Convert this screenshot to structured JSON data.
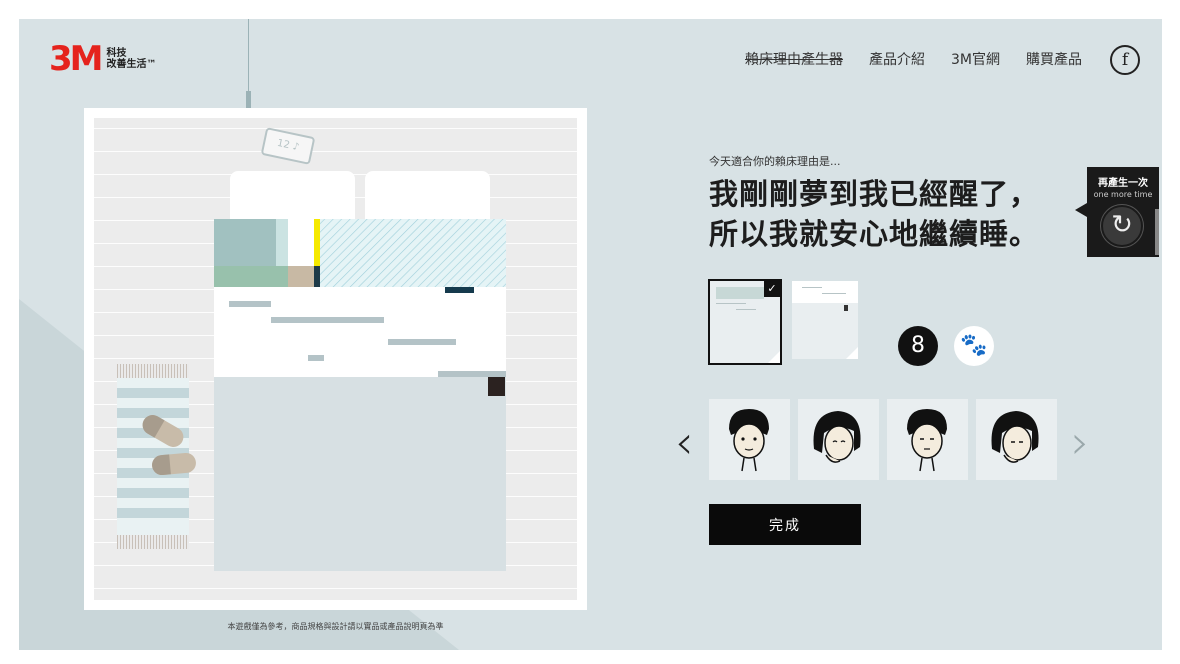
{
  "brand": {
    "logo_mark": "3M",
    "logo_line1": "科技",
    "logo_line2": "改善生活™"
  },
  "nav": {
    "items": [
      "賴床理由產生器",
      "產品介紹",
      "3M官網",
      "購買產品"
    ],
    "facebook_icon": "f"
  },
  "room": {
    "clock_text": "12 ♪",
    "disclaimer": "本遊戲僅為參考，商品規格與設計請以實品或產品說明頁為準"
  },
  "result": {
    "subtitle": "今天適合你的賴床理由是...",
    "line1": "我剛剛夢到我已經醒了，",
    "line2": "所以我就安心地繼續睡。"
  },
  "regen": {
    "title": "再產生一次",
    "subtitle": "one more time",
    "icon": "↻"
  },
  "thumbnails": {
    "selected_check": "✓"
  },
  "toggles": {
    "person_icon": "8",
    "paw_icon": "🐾"
  },
  "carousel": {
    "prev": "‹",
    "next": "›"
  },
  "done_label": "完成",
  "colors": {
    "accent": "#e5231d",
    "panel_bg": "#d8e2e5",
    "dark": "#0a0a0a"
  }
}
